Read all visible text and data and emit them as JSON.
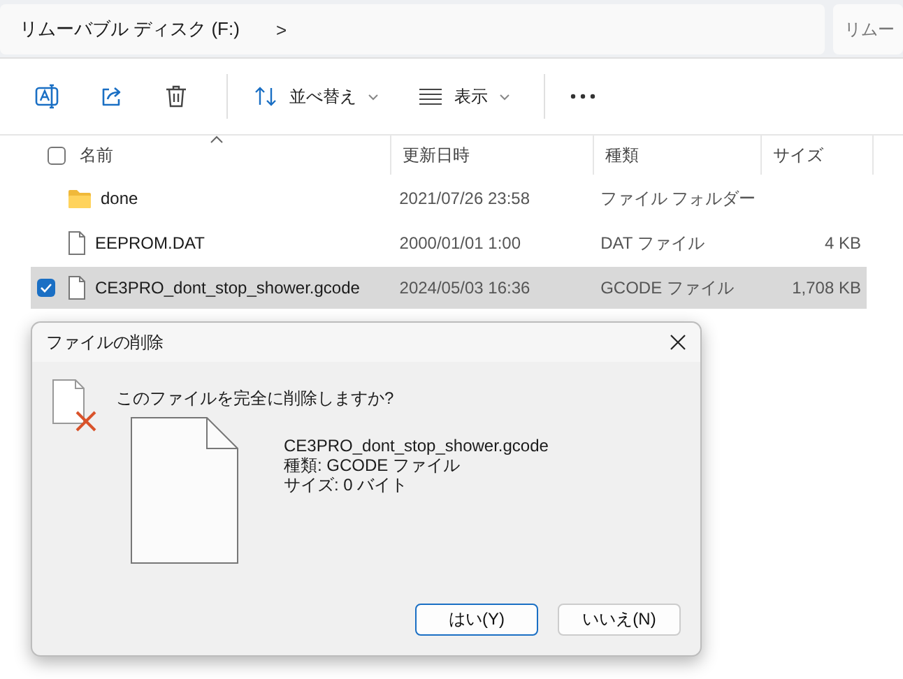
{
  "address_bar": {
    "path": "リムーバブル ディスク (F:)",
    "separator": ">"
  },
  "search": {
    "placeholder": "リムー"
  },
  "toolbar": {
    "sort_label": "並べ替え",
    "view_label": "表示"
  },
  "table": {
    "select_all": {
      "checked": false
    },
    "columns": [
      "名前",
      "更新日時",
      "種類",
      "サイズ"
    ],
    "rows": [
      {
        "kind": "folder",
        "name": "done",
        "modified": "2021/07/26 23:58",
        "type": "ファイル フォルダー",
        "selected": false
      },
      {
        "kind": "file",
        "name": "EEPROM.DAT",
        "modified": "2000/01/01 1:00",
        "type": "DAT ファイル",
        "size": "4 KB",
        "selected": false
      },
      {
        "kind": "file",
        "name": "CE3PRO_dont_stop_shower.gcode",
        "modified": "2024/05/03 16:36",
        "type": "GCODE ファイル",
        "size": "1,708 KB",
        "selected": true
      }
    ]
  },
  "dialog": {
    "title": "ファイルの削除",
    "question": "このファイルを完全に削除しますか?",
    "details": [
      "CE3PRO_dont_stop_shower.gcode",
      "種類: GCODE ファイル",
      "サイズ: 0 バイト"
    ],
    "buttons": [
      {
        "label": "はい(Y)",
        "selected": true
      },
      {
        "label": "いいえ(N)",
        "selected": false
      }
    ]
  }
}
